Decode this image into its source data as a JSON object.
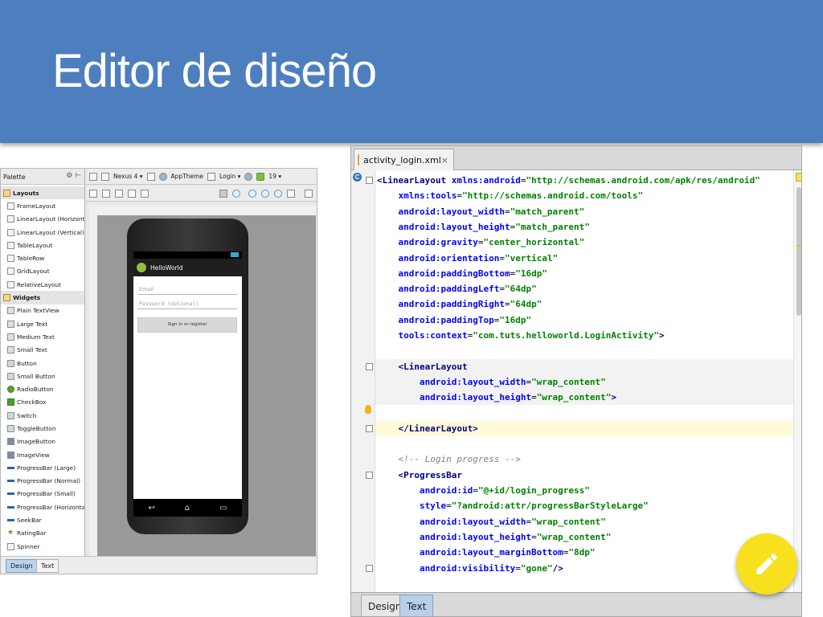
{
  "slide": {
    "title": "Editor de diseño"
  },
  "design": {
    "palette_title": "Palette",
    "palette_tools": "⚙ ⊢",
    "palette_items": [
      {
        "label": "Layouts",
        "category": true,
        "icon": "folder-icon"
      },
      {
        "label": "FrameLayout",
        "icon": "layout-icon"
      },
      {
        "label": "LinearLayout (Horizontal)",
        "icon": "layout-icon"
      },
      {
        "label": "LinearLayout (Vertical)",
        "icon": "layout-icon"
      },
      {
        "label": "TableLayout",
        "icon": "layout-icon"
      },
      {
        "label": "TableRow",
        "icon": "layout-icon"
      },
      {
        "label": "GridLayout",
        "icon": "layout-icon"
      },
      {
        "label": "RelativeLayout",
        "icon": "layout-icon"
      },
      {
        "label": "Widgets",
        "category": true,
        "icon": "folder-icon"
      },
      {
        "label": "Plain TextView",
        "icon": "text-icon"
      },
      {
        "label": "Large Text",
        "icon": "text-icon"
      },
      {
        "label": "Medium Text",
        "icon": "text-icon"
      },
      {
        "label": "Small Text",
        "icon": "text-icon"
      },
      {
        "label": "Button",
        "icon": "button-icon"
      },
      {
        "label": "Small Button",
        "icon": "button-icon"
      },
      {
        "label": "RadioButton",
        "icon": "radio-icon"
      },
      {
        "label": "CheckBox",
        "icon": "checkbox-icon"
      },
      {
        "label": "Switch",
        "icon": "switch-icon"
      },
      {
        "label": "ToggleButton",
        "icon": "button-icon"
      },
      {
        "label": "ImageButton",
        "icon": "image-icon"
      },
      {
        "label": "ImageView",
        "icon": "image-icon"
      },
      {
        "label": "ProgressBar (Large)",
        "icon": "progress-icon"
      },
      {
        "label": "ProgressBar (Normal)",
        "icon": "progress-icon"
      },
      {
        "label": "ProgressBar (Small)",
        "icon": "progress-icon"
      },
      {
        "label": "ProgressBar (Horizontal)",
        "icon": "progress-icon"
      },
      {
        "label": "SeekBar",
        "icon": "seekbar-icon"
      },
      {
        "label": "RatingBar",
        "icon": "star-icon"
      },
      {
        "label": "Spinner",
        "icon": "spinner-icon"
      }
    ],
    "toolbar": {
      "device": "Nexus 4 ▾",
      "theme": "AppTheme",
      "activity": "Login ▾",
      "api": "19 ▾"
    },
    "preview": {
      "app_title": "HelloWorld",
      "email_hint": "Email",
      "password_hint": "Password (optional)",
      "signin_label": "Sign in or register",
      "nav_back": "↩",
      "nav_home": "⌂",
      "nav_recent": "▭"
    },
    "tabs": {
      "design": "Design",
      "text": "Text"
    }
  },
  "xml": {
    "file_tab": "activity_login.xml",
    "close": "×",
    "badge": "C",
    "tabs": {
      "design": "Design",
      "text": "Text"
    },
    "lines": [
      [
        [
          "tag",
          "<LinearLayout "
        ],
        [
          "attr",
          "xmlns:android"
        ],
        [
          "plain",
          "="
        ],
        [
          "val",
          "\"http://schemas.android.com/apk/res/android\""
        ]
      ],
      [
        [
          "plain",
          "    "
        ],
        [
          "attr",
          "xmlns:tools"
        ],
        [
          "plain",
          "="
        ],
        [
          "val",
          "\"http://schemas.android.com/tools\""
        ]
      ],
      [
        [
          "plain",
          "    "
        ],
        [
          "attr",
          "android:layout_width"
        ],
        [
          "plain",
          "="
        ],
        [
          "val",
          "\"match_parent\""
        ]
      ],
      [
        [
          "plain",
          "    "
        ],
        [
          "attr",
          "android:layout_height"
        ],
        [
          "plain",
          "="
        ],
        [
          "val",
          "\"match_parent\""
        ]
      ],
      [
        [
          "plain",
          "    "
        ],
        [
          "attr",
          "android:gravity"
        ],
        [
          "plain",
          "="
        ],
        [
          "val",
          "\"center_horizontal\""
        ]
      ],
      [
        [
          "plain",
          "    "
        ],
        [
          "attr",
          "android:orientation"
        ],
        [
          "plain",
          "="
        ],
        [
          "val",
          "\"vertical\""
        ]
      ],
      [
        [
          "plain",
          "    "
        ],
        [
          "attr",
          "android:paddingBottom"
        ],
        [
          "plain",
          "="
        ],
        [
          "val",
          "\"16dp\""
        ]
      ],
      [
        [
          "plain",
          "    "
        ],
        [
          "attr",
          "android:paddingLeft"
        ],
        [
          "plain",
          "="
        ],
        [
          "val",
          "\"64dp\""
        ]
      ],
      [
        [
          "plain",
          "    "
        ],
        [
          "attr",
          "android:paddingRight"
        ],
        [
          "plain",
          "="
        ],
        [
          "val",
          "\"64dp\""
        ]
      ],
      [
        [
          "plain",
          "    "
        ],
        [
          "attr",
          "android:paddingTop"
        ],
        [
          "plain",
          "="
        ],
        [
          "val",
          "\"16dp\""
        ]
      ],
      [
        [
          "plain",
          "    "
        ],
        [
          "attr",
          "tools:context"
        ],
        [
          "plain",
          "="
        ],
        [
          "val",
          "\"com.tuts.helloworld.LoginActivity\""
        ],
        [
          "tag",
          ">"
        ]
      ],
      [
        [
          "plain",
          ""
        ]
      ],
      [
        [
          "plain",
          "    "
        ],
        [
          "tag",
          "<LinearLayout"
        ]
      ],
      [
        [
          "plain",
          "        "
        ],
        [
          "attr",
          "android:layout_width"
        ],
        [
          "plain",
          "="
        ],
        [
          "val",
          "\"wrap_content\""
        ]
      ],
      [
        [
          "plain",
          "        "
        ],
        [
          "attr",
          "android:layout_height"
        ],
        [
          "plain",
          "="
        ],
        [
          "val",
          "\"wrap_content\""
        ],
        [
          "tag",
          ">"
        ]
      ],
      [
        [
          "plain",
          ""
        ]
      ],
      [
        [
          "plain",
          "    "
        ],
        [
          "tag",
          "</LinearLayout>"
        ]
      ],
      [
        [
          "plain",
          ""
        ]
      ],
      [
        [
          "plain",
          "    "
        ],
        [
          "com",
          "<!-- Login progress -->"
        ]
      ],
      [
        [
          "plain",
          "    "
        ],
        [
          "tag",
          "<ProgressBar"
        ]
      ],
      [
        [
          "plain",
          "        "
        ],
        [
          "attr",
          "android:id"
        ],
        [
          "plain",
          "="
        ],
        [
          "val",
          "\"@+id/login_progress\""
        ]
      ],
      [
        [
          "plain",
          "        "
        ],
        [
          "attr",
          "style"
        ],
        [
          "plain",
          "="
        ],
        [
          "val",
          "\"?android:attr/progressBarStyleLarge\""
        ]
      ],
      [
        [
          "plain",
          "        "
        ],
        [
          "attr",
          "android:layout_width"
        ],
        [
          "plain",
          "="
        ],
        [
          "val",
          "\"wrap_content\""
        ]
      ],
      [
        [
          "plain",
          "        "
        ],
        [
          "attr",
          "android:layout_height"
        ],
        [
          "plain",
          "="
        ],
        [
          "val",
          "\"wrap_content\""
        ]
      ],
      [
        [
          "plain",
          "        "
        ],
        [
          "attr",
          "android:layout_marginBottom"
        ],
        [
          "plain",
          "="
        ],
        [
          "val",
          "\"8dp\""
        ]
      ],
      [
        [
          "plain",
          "        "
        ],
        [
          "attr",
          "android:visibility"
        ],
        [
          "plain",
          "="
        ],
        [
          "val",
          "\"gone\""
        ],
        [
          "tag",
          "/>"
        ]
      ]
    ]
  },
  "colors": {
    "header": "#4d7fbe",
    "fab": "#f8e01f",
    "tag": "#000080",
    "attr": "#0000ff",
    "val": "#008000"
  },
  "fab": {
    "icon": "edit-pencil-icon"
  }
}
